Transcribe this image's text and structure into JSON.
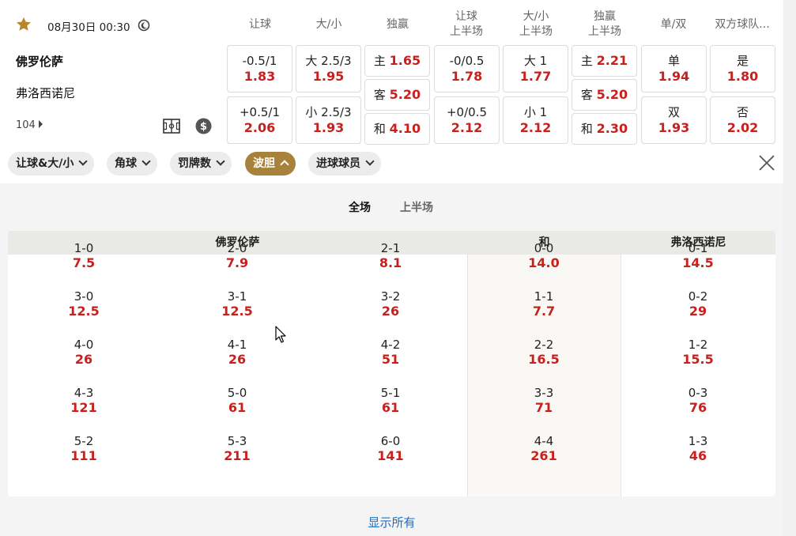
{
  "match": {
    "datetime": "08月30日 00:30",
    "home": "佛罗伦萨",
    "away": "弗洛西诺尼",
    "more_count": "104"
  },
  "columns": [
    "让球",
    "大/小",
    "独赢",
    "让球\n上半场",
    "大/小\n上半场",
    "独赢\n上半场",
    "单/双",
    "双方球队..."
  ],
  "odds": {
    "hcp": [
      {
        "l": "-0.5/1",
        "v": "1.83"
      },
      {
        "l": "+0.5/1",
        "v": "2.06"
      }
    ],
    "ou": [
      {
        "l": "大 2.5/3",
        "v": "1.95"
      },
      {
        "l": "小 2.5/3",
        "v": "1.93"
      }
    ],
    "ml": [
      {
        "l": "主",
        "v": "1.65"
      },
      {
        "l": "客",
        "v": "5.20"
      },
      {
        "l": "和",
        "v": "4.10"
      }
    ],
    "hcp_h1": [
      {
        "l": "-0/0.5",
        "v": "1.78"
      },
      {
        "l": "+0/0.5",
        "v": "2.12"
      }
    ],
    "ou_h1": [
      {
        "l": "大 1",
        "v": "1.77"
      },
      {
        "l": "小 1",
        "v": "2.12"
      }
    ],
    "ml_h1": [
      {
        "l": "主",
        "v": "2.21"
      },
      {
        "l": "客",
        "v": "5.20"
      },
      {
        "l": "和",
        "v": "2.30"
      }
    ],
    "oe": [
      {
        "l": "单",
        "v": "1.94"
      },
      {
        "l": "双",
        "v": "1.93"
      }
    ],
    "btts": [
      {
        "l": "是",
        "v": "1.80"
      },
      {
        "l": "否",
        "v": "2.02"
      }
    ]
  },
  "filters": [
    "让球&大/小",
    "角球",
    "罚牌数",
    "波胆",
    "进球球员"
  ],
  "active_filter": "波胆",
  "tabs": {
    "full": "全场",
    "half": "上半场"
  },
  "grid_headers": {
    "home": "佛罗伦萨",
    "draw": "和",
    "away": "弗洛西诺尼"
  },
  "correct_score": [
    [
      {
        "s": "1-0",
        "o": "7.5"
      },
      {
        "s": "2-0",
        "o": "7.9"
      },
      {
        "s": "2-1",
        "o": "8.1"
      },
      {
        "s": "0-0",
        "o": "14.0"
      },
      {
        "s": "0-1",
        "o": "14.5"
      }
    ],
    [
      {
        "s": "3-0",
        "o": "12.5"
      },
      {
        "s": "3-1",
        "o": "12.5"
      },
      {
        "s": "3-2",
        "o": "26"
      },
      {
        "s": "1-1",
        "o": "7.7"
      },
      {
        "s": "0-2",
        "o": "29"
      }
    ],
    [
      {
        "s": "4-0",
        "o": "26"
      },
      {
        "s": "4-1",
        "o": "26"
      },
      {
        "s": "4-2",
        "o": "51"
      },
      {
        "s": "2-2",
        "o": "16.5"
      },
      {
        "s": "1-2",
        "o": "15.5"
      }
    ],
    [
      {
        "s": "4-3",
        "o": "121"
      },
      {
        "s": "5-0",
        "o": "61"
      },
      {
        "s": "5-1",
        "o": "61"
      },
      {
        "s": "3-3",
        "o": "71"
      },
      {
        "s": "0-3",
        "o": "76"
      }
    ],
    [
      {
        "s": "5-2",
        "o": "111"
      },
      {
        "s": "5-3",
        "o": "211"
      },
      {
        "s": "6-0",
        "o": "141"
      },
      {
        "s": "4-4",
        "o": "261"
      },
      {
        "s": "1-3",
        "o": "46"
      }
    ]
  ],
  "show_all": "显示所有",
  "colors": {
    "odds": "#c8201d",
    "active_chip": "#a8823a",
    "link": "#1a6fc7",
    "star": "#b8862a"
  }
}
